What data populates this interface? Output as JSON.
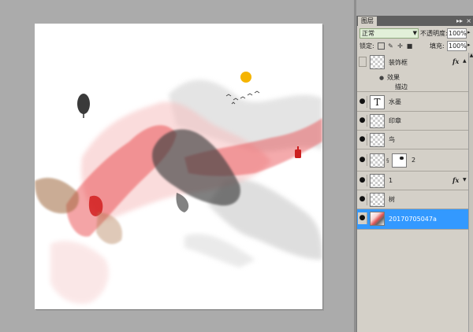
{
  "canvas": {
    "palette": {
      "red_ink": "#e8383b",
      "pink_ink": "#f2a0a0",
      "black_ink": "#3c3c3c",
      "gray_ink": "#b8b8b8",
      "brown_ink": "#a06a40",
      "sun": "#f5b400",
      "seal": "#cc1f1f"
    },
    "elements": [
      "tree-icon",
      "sun-icon",
      "birds-icon",
      "seal-stamp",
      "ink-wash"
    ]
  },
  "layers_panel": {
    "tab_label": "图层",
    "collapse_glyph": "▸▸",
    "close_glyph": "×",
    "blend_mode": "正常",
    "opacity_label": "不透明度:",
    "opacity_value": "100%",
    "lock_label": "锁定:",
    "fill_label": "填充:",
    "fill_value": "100%",
    "layers": [
      {
        "name": "装饰框",
        "visible": false,
        "thumb": "transparent",
        "fx": "fx",
        "effects_label": "效果",
        "effect": "描边"
      },
      {
        "name": "水墨",
        "visible": true,
        "thumb": "text",
        "thumb_glyph": "T"
      },
      {
        "name": "印章",
        "visible": true,
        "thumb": "transparent"
      },
      {
        "name": "鸟",
        "visible": true,
        "thumb": "transparent"
      },
      {
        "name": "2",
        "visible": true,
        "thumb": "transparent",
        "has_mask": true
      },
      {
        "name": "1",
        "visible": true,
        "thumb": "transparent",
        "fx": "fx"
      },
      {
        "name": "树",
        "visible": true,
        "thumb": "transparent"
      },
      {
        "name": "20170705047a",
        "visible": true,
        "thumb": "photo",
        "selected": true
      }
    ]
  }
}
